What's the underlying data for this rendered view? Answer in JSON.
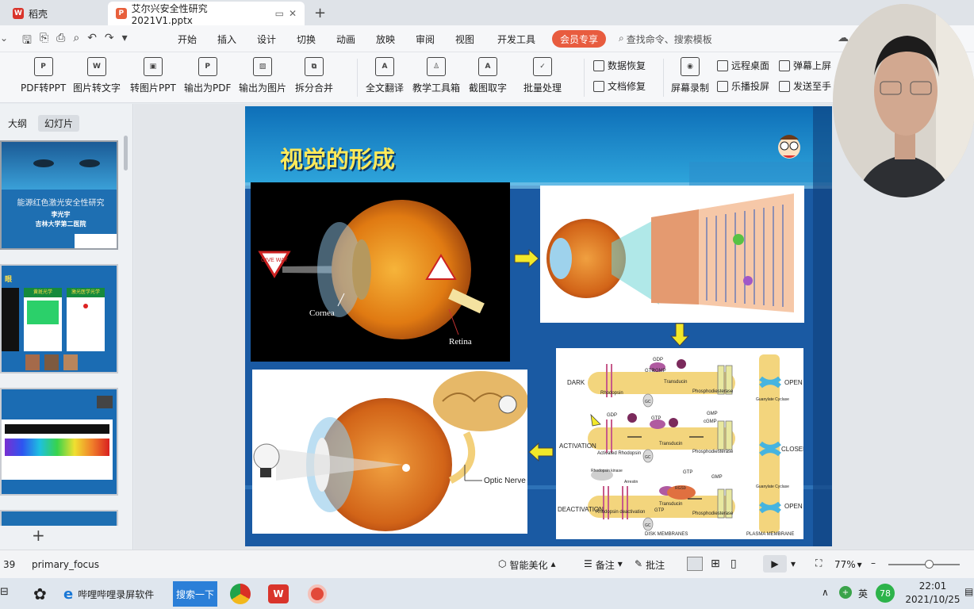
{
  "tabs": [
    {
      "label": "稻壳"
    },
    {
      "label": "艾尔兴安全性研究2021V1.pptx"
    }
  ],
  "menus": [
    "开始",
    "插入",
    "设计",
    "切换",
    "动画",
    "放映",
    "审阅",
    "视图",
    "开发工具"
  ],
  "vip_label": "会员专享",
  "search_placeholder": "查找命令、搜索模板",
  "ribbon": {
    "big": [
      "PDF转PPT",
      "图片转文字",
      "转图片PPT",
      "输出为PDF",
      "输出为图片",
      "拆分合并",
      "全文翻译",
      "教学工具箱",
      "截图取字",
      "批量处理",
      "屏幕录制"
    ],
    "small": [
      "数据恢复",
      "文档修复",
      "远程桌面",
      "弹幕上屏",
      "乐播投屏",
      "发送至手"
    ]
  },
  "left_panel": {
    "tab_outline": "大纲",
    "tab_slides": "幻灯片",
    "thumb1": {
      "title": "能源红色激光安全性研究",
      "author": "李光宇",
      "org": "吉林大学第二医院"
    },
    "thumb2": {
      "header": "眼",
      "cols": [
        "激光光学",
        "黄斑光学",
        "激光医学光学"
      ]
    }
  },
  "slide": {
    "title": "视觉的形成",
    "labels": {
      "cornea": "Cornea",
      "retina": "Retina",
      "give_way": "GIVE WAY",
      "optic_nerve": "Optic Nerve",
      "dark": "DARK",
      "activation": "ACTIVATION",
      "deactivation": "DEACTIVATION",
      "open": "OPEN",
      "closed": "CLOSED",
      "rhodopsin": "Rhodopsin",
      "transducin": "Transducin",
      "phosphodiesterase": "Phosphodiesterase",
      "activated_rhodopsin": "Activated Rhodopsin",
      "guanylate_cyclase": "Guanylate Cyclase",
      "disk_membranes": "DISK MEMBRANES",
      "plasma_membrane": "PLASMA MEMBRANE",
      "rhodopsin_deactivation": "Rhodopsin deactivation",
      "gdp": "GDP",
      "gtp": "GTP",
      "cgmp": "cGMP",
      "gmp": "GMP",
      "gc": "GC",
      "arrestin": "Arrestin",
      "rhodopsin_kinase": "Rhodopsin kinase",
      "rgs9": "RGS9"
    }
  },
  "status": {
    "slide_num": "39",
    "theme": "primary_focus",
    "beautify": "智能美化",
    "notes": "备注",
    "comment": "批注",
    "zoom": "77%"
  },
  "taskbar": {
    "app1": "哔哩哔哩录屏软件",
    "search_btn": "搜索一下",
    "ime": "英",
    "badge": "78",
    "time": "22:01",
    "date": "2021/10/25"
  }
}
